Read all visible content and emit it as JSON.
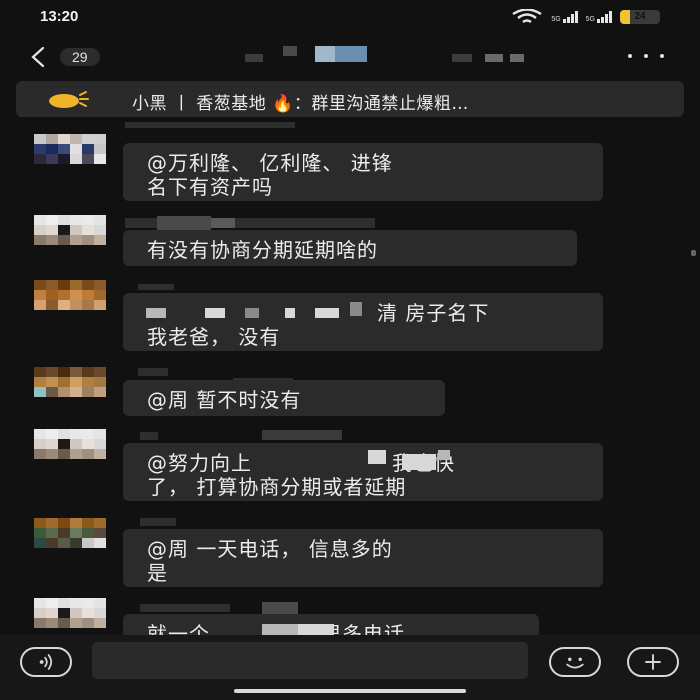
{
  "status_bar": {
    "time": "13:20",
    "network_1": "5G",
    "network_2": "5G",
    "battery": "24",
    "battery_level": 0.24
  },
  "header": {
    "unread_count": "29"
  },
  "pinned_notice": {
    "text": "小黑 丨 香葱基地 🔥：群里沟通禁止爆粗…"
  },
  "messages": [
    {
      "lines": [
        "@万利隆、 亿利隆、 进锋",
        "名下有资产吗"
      ]
    },
    {
      "lines": [
        "有没有协商分期延期啥的"
      ]
    },
    {
      "lines": [
        "清  房子名下",
        "我老爸，  没有"
      ]
    },
    {
      "lines": [
        "@周  暂不时没有"
      ]
    },
    {
      "lines": [
        "@努力向上",
        "我也快",
        "了，  打算协商分期或者延期"
      ]
    },
    {
      "lines": [
        "@周  一天电话，  信息多的",
        "是"
      ]
    },
    {
      "lines": [
        "就一个",
        "贷很多电话"
      ]
    }
  ],
  "colors": {
    "background": "#111111",
    "bubble": "#2b2b2b",
    "notice_icon": "#f0b429"
  },
  "icons": {
    "back": "chevron-left-icon",
    "more": "more-dots-icon",
    "notice": "speaker-icon",
    "voice": "voice-icon",
    "emoji": "smiley-icon",
    "add": "plus-icon"
  }
}
